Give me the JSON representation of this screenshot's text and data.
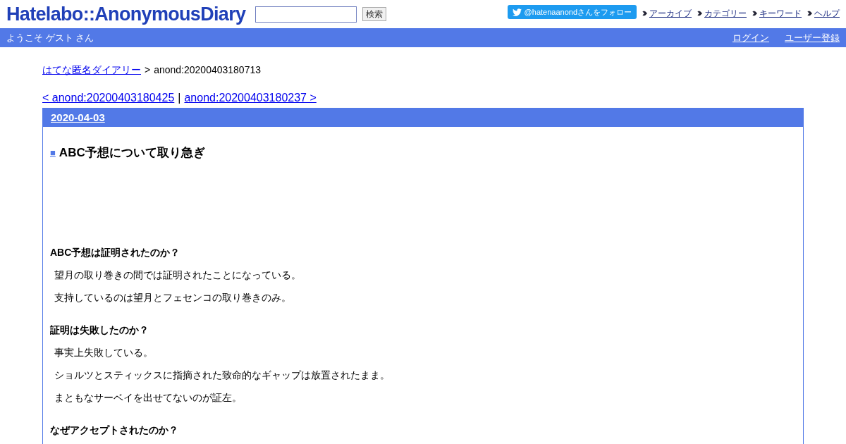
{
  "header": {
    "logo": "Hatelabo::AnonymousDiary",
    "search": {
      "button": "検索"
    },
    "follow_button": "@hatenaanondさんをフォロー",
    "nav": [
      "アーカイブ",
      "カテゴリー",
      "キーワード",
      "ヘルプ"
    ]
  },
  "welcome_bar": {
    "greeting": "ようこそ ゲスト さん",
    "links": [
      "ログイン",
      "ユーザー登録"
    ]
  },
  "breadcrumb": {
    "link": "はてな匿名ダイアリー",
    "separator": ">",
    "current": "anond:20200403180713"
  },
  "pager": {
    "prev": "< anond:20200403180425",
    "separator": "|",
    "next": "anond:20200403180237 >"
  },
  "day": {
    "date": "2020-04-03",
    "marker": "■",
    "title": "ABC予想について取り急ぎ",
    "sections": [
      {
        "heading": "ABC予想は証明されたのか？",
        "paragraphs": [
          "望月の取り巻きの間では証明されたことになっている。",
          "支持しているのは望月とフェセンコの取り巻きのみ。"
        ]
      },
      {
        "heading": "証明は失敗したのか？",
        "paragraphs": [
          "事実上失敗している。",
          "ショルツとスティックスに指摘された致命的なギャップは放置されたまま。",
          "まともなサーベイを出せてないのが証左。"
        ]
      },
      {
        "heading": "なぜアクセプトされたのか？"
      }
    ]
  }
}
